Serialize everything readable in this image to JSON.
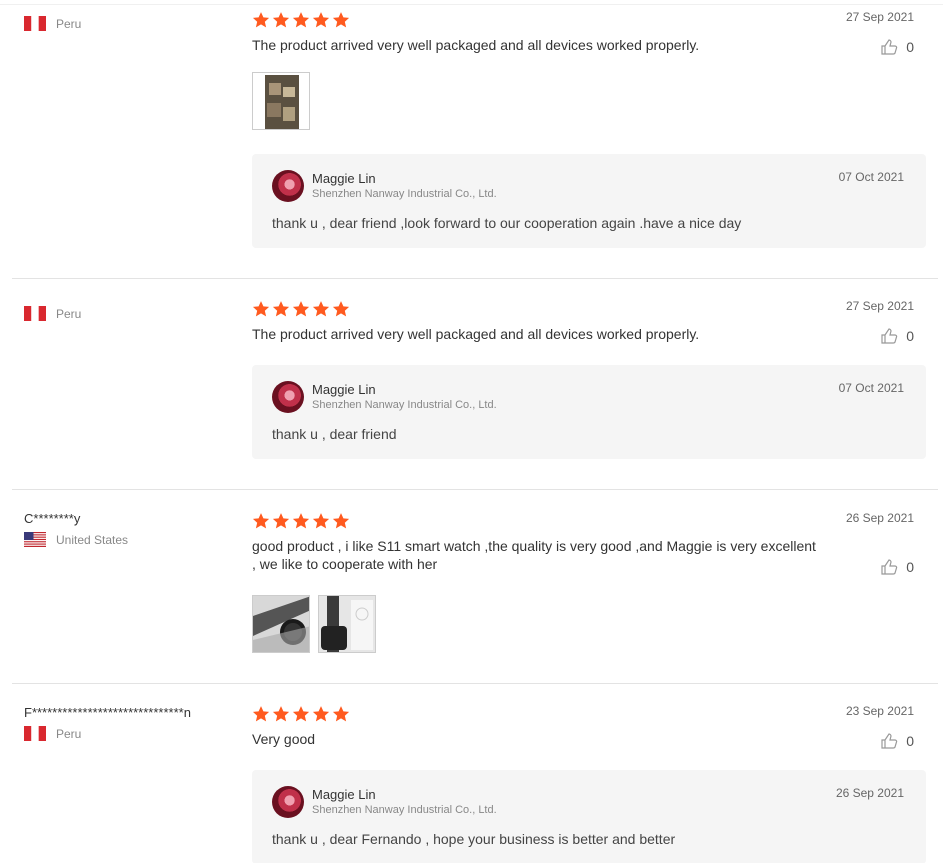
{
  "colors": {
    "star": "#ff5a1f",
    "flag_red": "#d9282f"
  },
  "icons": {
    "star": "star-icon",
    "like": "thumbs-up-icon"
  },
  "reviews": [
    {
      "user": "",
      "country": "Peru",
      "rating": 5,
      "date": "27 Sep 2021",
      "text": "The product arrived very well packaged and all devices worked properly.",
      "likes": "0",
      "photo_count": 1,
      "reply": {
        "name": "Maggie Lin",
        "company": "Shenzhen Nanway Industrial Co., Ltd.",
        "date": "07 Oct 2021",
        "text": "thank u , dear friend ,look forward to our cooperation again .have a nice day"
      }
    },
    {
      "user": "",
      "country": "Peru",
      "rating": 5,
      "date": "27 Sep 2021",
      "text": "The product arrived very well packaged and all devices worked properly.",
      "likes": "0",
      "reply": {
        "name": "Maggie Lin",
        "company": "Shenzhen Nanway Industrial Co., Ltd.",
        "date": "07 Oct 2021",
        "text": "thank u , dear friend"
      }
    },
    {
      "user": "C********y",
      "country": "United States",
      "rating": 5,
      "date": "26 Sep 2021",
      "text": "good product , i like S11 smart watch ,the quality is very good ,and Maggie is very excellent , we like to cooperate with her",
      "likes": "0",
      "photo_count": 2
    },
    {
      "user": "F******************************n",
      "country": "Peru",
      "rating": 5,
      "date": "23 Sep 2021",
      "text": "Very good",
      "likes": "0",
      "reply": {
        "name": "Maggie Lin",
        "company": "Shenzhen Nanway Industrial Co., Ltd.",
        "date": "26 Sep 2021",
        "text": "thank u , dear Fernando , hope your business is better and better"
      }
    }
  ]
}
